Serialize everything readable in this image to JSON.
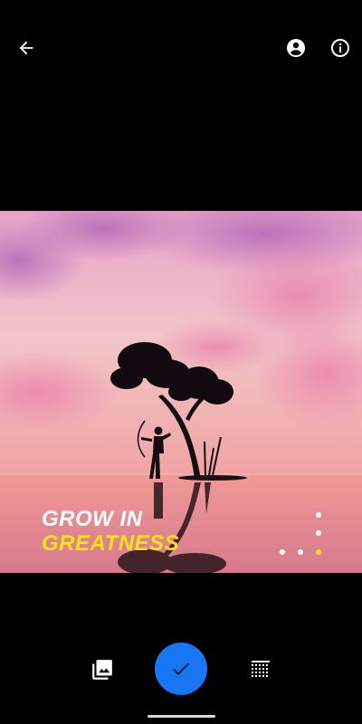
{
  "toolbar": {
    "back_icon": "arrow-back-icon",
    "account_icon": "account-circle-icon",
    "info_icon": "info-icon"
  },
  "preview": {
    "headline_line1": "GROW IN",
    "headline_line2": "GREATNESS",
    "headline_line1_color": "#ffffff",
    "headline_line2_color": "#f5e21a",
    "dots_color": "#ffffff",
    "dots_accent_color": "#f5e21a"
  },
  "bottom_bar": {
    "gallery_icon": "photo-library-icon",
    "confirm_icon": "check-icon",
    "grid_icon": "dot-grid-icon",
    "accent": "#1976f2"
  }
}
